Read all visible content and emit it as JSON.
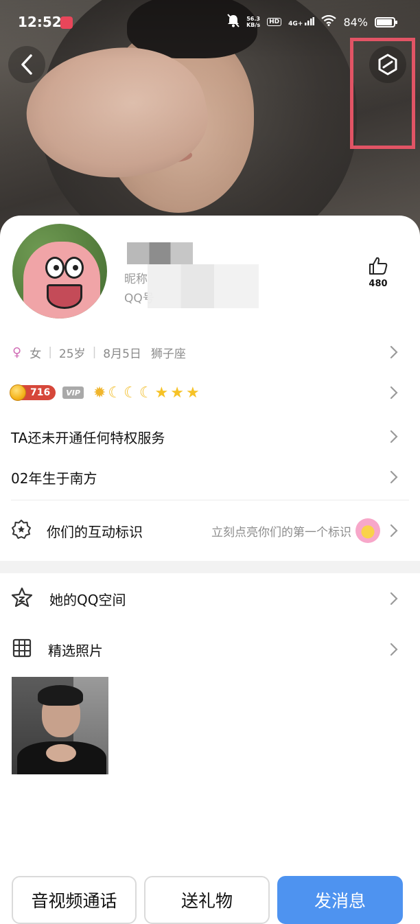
{
  "status_bar": {
    "time": "12:52",
    "net_speed_top": "56.3",
    "net_speed_bottom": "KB/s",
    "hd": "HD",
    "signal": "4G+",
    "battery": "84%",
    "battery_level": 0.84
  },
  "profile": {
    "nickname_prefix": "昵称",
    "qq_prefix": "QQ号",
    "likes": "480"
  },
  "info": {
    "gender": "女",
    "age": "25岁",
    "birthday": "8月5日",
    "zodiac": "狮子座"
  },
  "level": {
    "number": "716",
    "vip_label": "VIP"
  },
  "privilege_text": "TA还未开通任何特权服务",
  "bio_text": "02年生于南方",
  "interaction": {
    "label": "你们的互动标识",
    "hint": "立刻点亮你们的第一个标识"
  },
  "qzone_label": "她的QQ空间",
  "photos_label": "精选照片",
  "buttons": {
    "call": "音视频通话",
    "gift": "送礼物",
    "message": "发消息"
  },
  "colors": {
    "accent": "#4e93f0",
    "highlight_box": "#e25465",
    "gender_icon": "#d06db5"
  },
  "icons": [
    "back-icon",
    "menu-icon",
    "thumbs-up-icon",
    "female-icon",
    "chevron-right-icon",
    "badge-icon",
    "star-icon",
    "grid-icon",
    "level-badge-icon",
    "flower-icon"
  ]
}
